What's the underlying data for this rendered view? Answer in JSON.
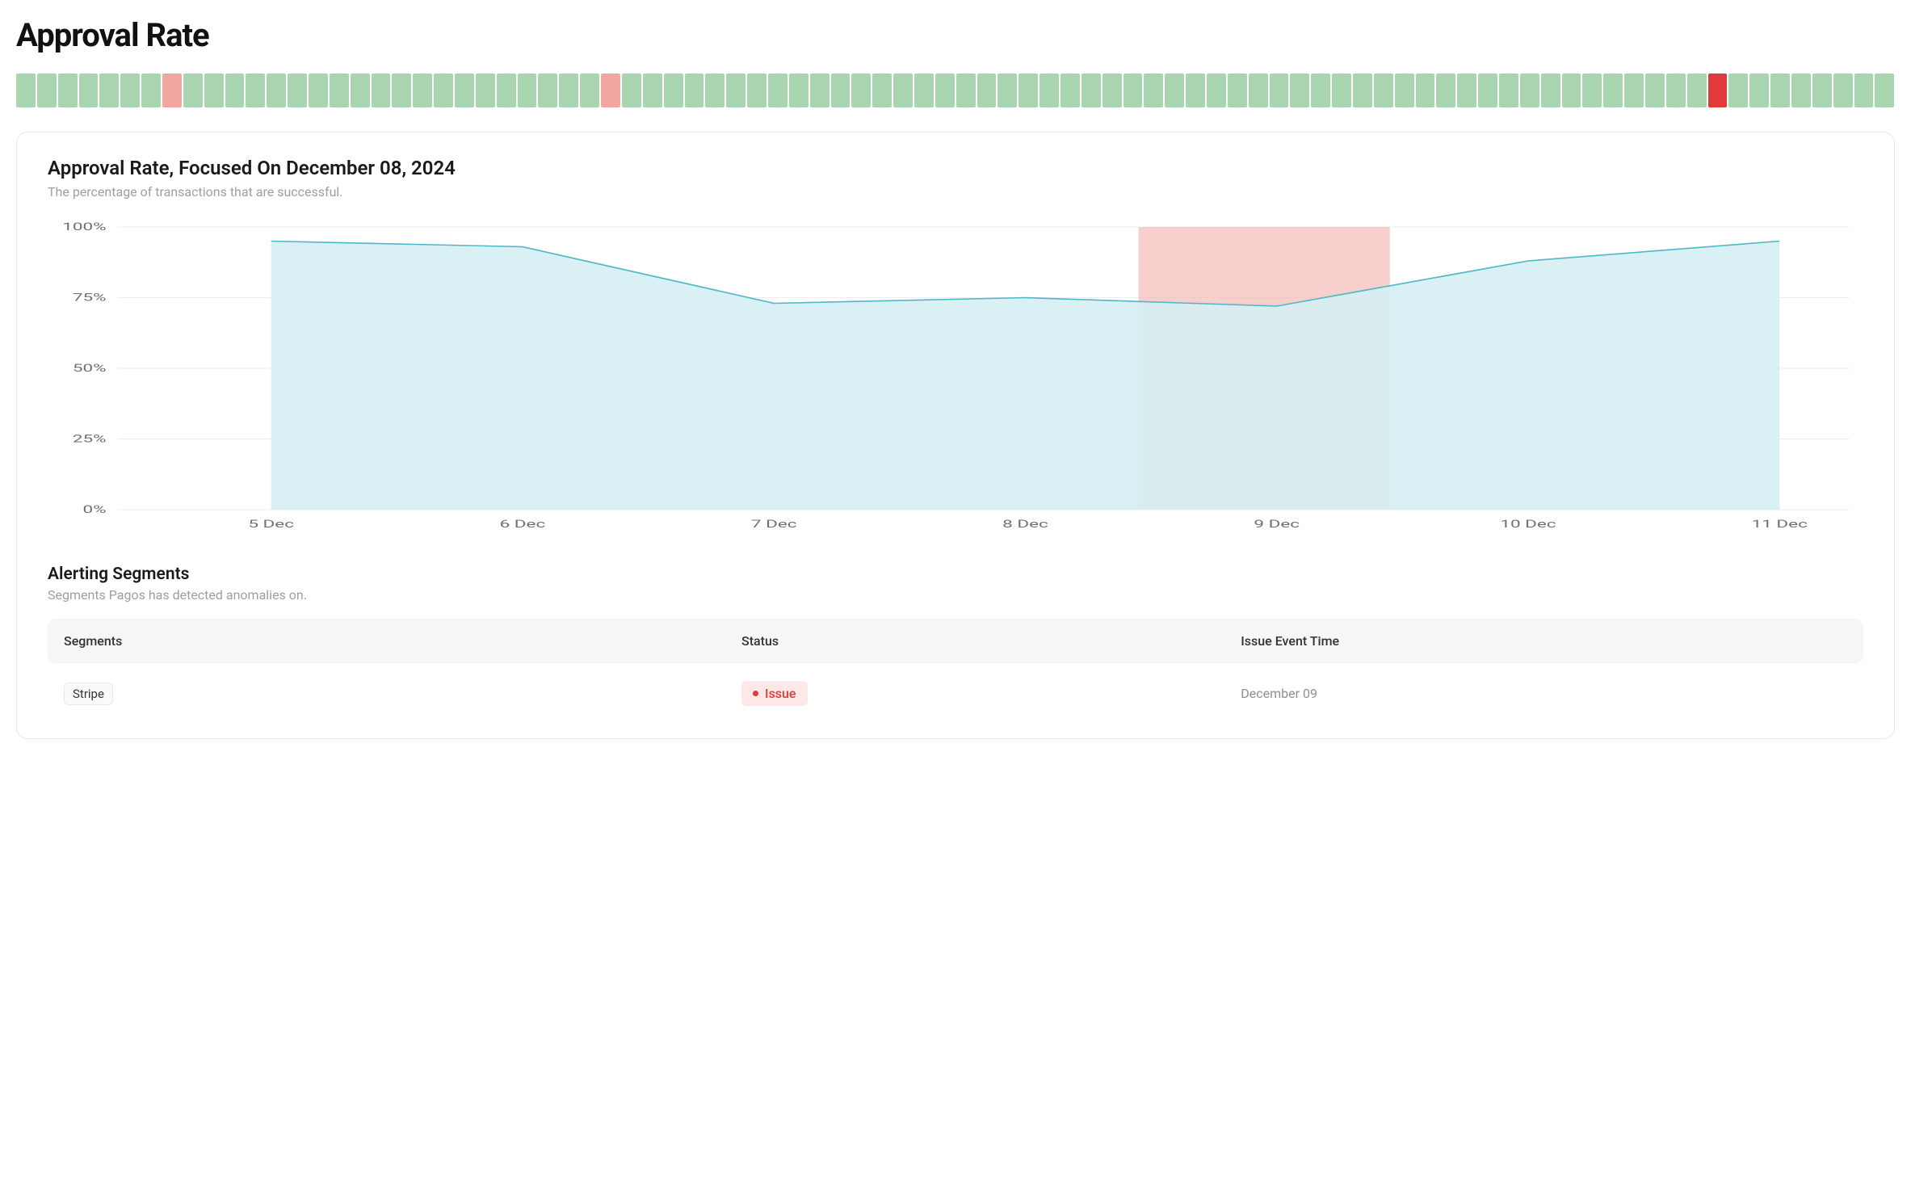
{
  "page_title": "Approval Rate",
  "status_strip": {
    "total": 90,
    "anomalies": [
      {
        "index": 7,
        "severity": "warn"
      },
      {
        "index": 28,
        "severity": "warn"
      },
      {
        "index": 81,
        "severity": "err"
      }
    ]
  },
  "chart": {
    "title": "Approval Rate, Focused On December 08, 2024",
    "subtitle": "The percentage of transactions that are successful."
  },
  "chart_data": {
    "type": "area",
    "title": "Approval Rate, Focused On December 08, 2024",
    "xlabel": "",
    "ylabel": "",
    "ylim": [
      0,
      100
    ],
    "y_ticks": [
      "0%",
      "25%",
      "50%",
      "75%",
      "100%"
    ],
    "categories": [
      "5 Dec",
      "6 Dec",
      "7 Dec",
      "8 Dec",
      "9 Dec",
      "10 Dec",
      "11 Dec"
    ],
    "values": [
      95,
      93,
      73,
      75,
      72,
      88,
      95
    ],
    "highlight_band": {
      "center_index": 4,
      "color": "#f2b7b2"
    }
  },
  "segments": {
    "title": "Alerting Segments",
    "subtitle": "Segments Pagos has detected anomalies on.",
    "columns": {
      "segments": "Segments",
      "status": "Status",
      "time": "Issue Event Time"
    },
    "rows": [
      {
        "segment": "Stripe",
        "status": "Issue",
        "time": "December 09"
      }
    ]
  }
}
